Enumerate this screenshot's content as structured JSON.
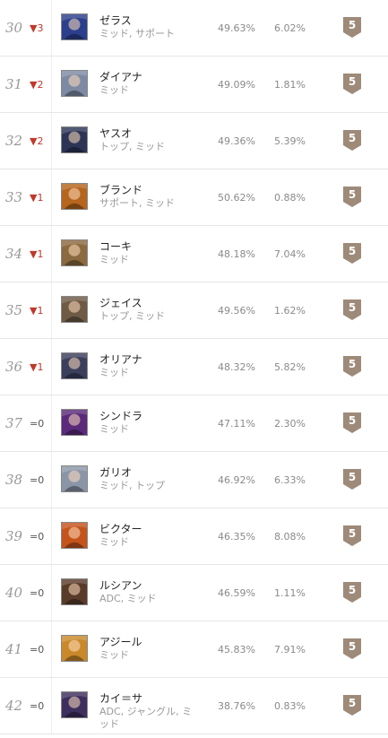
{
  "colors": {
    "tier_badge": "#9e8a79",
    "rank_down": "#c0392b",
    "text_muted": "#9a9a9a"
  },
  "rows": [
    {
      "rank": "30",
      "change_icon": "▼",
      "change_value": "3",
      "direction": "down",
      "name": "ゼラス",
      "roles": "ミッド, サポート",
      "win_rate": "49.63%",
      "pick_rate": "6.02%",
      "tier": "5",
      "portrait_color": "#2b3f8c"
    },
    {
      "rank": "31",
      "change_icon": "▼",
      "change_value": "2",
      "direction": "down",
      "name": "ダイアナ",
      "roles": "ミッド",
      "win_rate": "49.09%",
      "pick_rate": "1.81%",
      "tier": "5",
      "portrait_color": "#7d8aa3"
    },
    {
      "rank": "32",
      "change_icon": "▼",
      "change_value": "2",
      "direction": "down",
      "name": "ヤスオ",
      "roles": "トップ, ミッド",
      "win_rate": "49.36%",
      "pick_rate": "5.39%",
      "tier": "5",
      "portrait_color": "#2c3556"
    },
    {
      "rank": "33",
      "change_icon": "▼",
      "change_value": "1",
      "direction": "down",
      "name": "ブランド",
      "roles": "サポート, ミッド",
      "win_rate": "50.62%",
      "pick_rate": "0.88%",
      "tier": "5",
      "portrait_color": "#b5651d"
    },
    {
      "rank": "34",
      "change_icon": "▼",
      "change_value": "1",
      "direction": "down",
      "name": "コーキ",
      "roles": "ミッド",
      "win_rate": "48.18%",
      "pick_rate": "7.04%",
      "tier": "5",
      "portrait_color": "#8c6a3f"
    },
    {
      "rank": "35",
      "change_icon": "▼",
      "change_value": "1",
      "direction": "down",
      "name": "ジェイス",
      "roles": "トップ, ミッド",
      "win_rate": "49.56%",
      "pick_rate": "1.62%",
      "tier": "5",
      "portrait_color": "#6e5a45"
    },
    {
      "rank": "36",
      "change_icon": "▼",
      "change_value": "1",
      "direction": "down",
      "name": "オリアナ",
      "roles": "ミッド",
      "win_rate": "48.32%",
      "pick_rate": "5.82%",
      "tier": "5",
      "portrait_color": "#3b3f5c"
    },
    {
      "rank": "37",
      "change_icon": "=",
      "change_value": "0",
      "direction": "same",
      "name": "シンドラ",
      "roles": "ミッド",
      "win_rate": "47.11%",
      "pick_rate": "2.30%",
      "tier": "5",
      "portrait_color": "#5b2a7a"
    },
    {
      "rank": "38",
      "change_icon": "=",
      "change_value": "0",
      "direction": "same",
      "name": "ガリオ",
      "roles": "ミッド, トップ",
      "win_rate": "46.92%",
      "pick_rate": "6.33%",
      "tier": "5",
      "portrait_color": "#8a96a8"
    },
    {
      "rank": "39",
      "change_icon": "=",
      "change_value": "0",
      "direction": "same",
      "name": "ビクター",
      "roles": "ミッド",
      "win_rate": "46.35%",
      "pick_rate": "8.08%",
      "tier": "5",
      "portrait_color": "#c4541c"
    },
    {
      "rank": "40",
      "change_icon": "=",
      "change_value": "0",
      "direction": "same",
      "name": "ルシアン",
      "roles": "ADC, ミッド",
      "win_rate": "46.59%",
      "pick_rate": "1.11%",
      "tier": "5",
      "portrait_color": "#5a3b2a"
    },
    {
      "rank": "41",
      "change_icon": "=",
      "change_value": "0",
      "direction": "same",
      "name": "アジール",
      "roles": "ミッド",
      "win_rate": "45.83%",
      "pick_rate": "7.91%",
      "tier": "5",
      "portrait_color": "#c9892a"
    },
    {
      "rank": "42",
      "change_icon": "=",
      "change_value": "0",
      "direction": "same",
      "name": "カイ＝サ",
      "roles": "ADC, ジャングル, ミッド",
      "win_rate": "38.76%",
      "pick_rate": "0.83%",
      "tier": "5",
      "portrait_color": "#3d2f5e"
    }
  ]
}
